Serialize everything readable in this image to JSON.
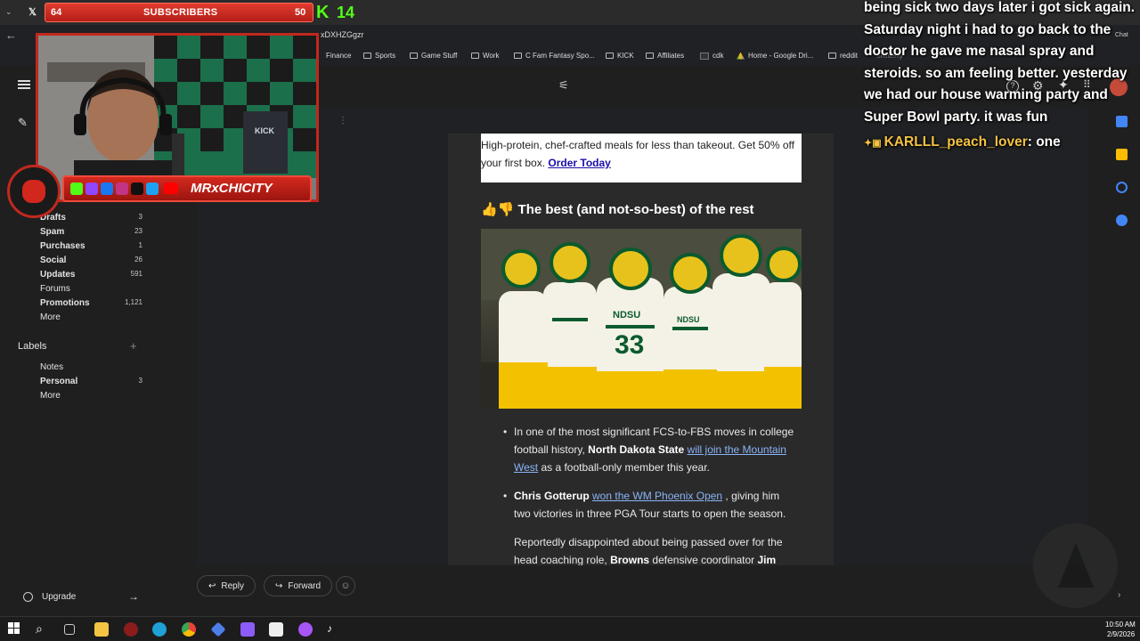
{
  "browser": {
    "url_fragment": "xDXHZGgzr",
    "bookmarks": [
      "Finance",
      "Sports",
      "Game Stuff",
      "Work",
      "C Fam Fantasy Spo...",
      "KICK",
      "Affiliates",
      "cdk",
      "Home - Google Dri...",
      "reddit",
      "Shutterfly"
    ]
  },
  "stream_overlay": {
    "subscribers_label": "SUBSCRIBERS",
    "subscribers_current": "64",
    "subscribers_goal": "50",
    "kick_count": "14",
    "streamer_name": "MRxCHICITY",
    "shirt_text": "KICK"
  },
  "sidebar": {
    "items": [
      {
        "label": "Drafts",
        "count": "3"
      },
      {
        "label": "Spam",
        "count": "23"
      },
      {
        "label": "Purchases",
        "count": "1"
      },
      {
        "label": "Social",
        "count": "26"
      },
      {
        "label": "Updates",
        "count": "591"
      },
      {
        "label": "Forums",
        "count": ""
      },
      {
        "label": "Promotions",
        "count": "1,121"
      },
      {
        "label": "More",
        "count": ""
      }
    ],
    "labels_heading": "Labels",
    "labels": [
      {
        "label": "Notes",
        "count": ""
      },
      {
        "label": "Personal",
        "count": "3"
      },
      {
        "label": "More",
        "count": ""
      }
    ],
    "upgrade": "Upgrade"
  },
  "email": {
    "promo_text": "High-protein, chef-crafted meals for less than takeout. Get 50% off your first box.",
    "promo_link": "Order Today",
    "section_heading": "The best (and not-so-best) of the rest",
    "section_emoji": "👍👎",
    "photo_jersey": "NDSU",
    "bullets": [
      {
        "pre": "In one of the most significant FCS-to-FBS moves in college football history, ",
        "bold": "North Dakota State",
        "link": "will join the Mountain West",
        "post": " as a football-only member this year."
      },
      {
        "pre": "",
        "bold": "Chris Gotterup",
        "link": "won the WM Phoenix Open",
        "post": " , giving him two victories in three PGA Tour starts to open the season."
      },
      {
        "pre": "Reportedly disappointed about being passed over for the head coaching role, ",
        "bold": "Browns",
        "link": "",
        "post": " defensive coordinator ",
        "bold2": "Jim"
      }
    ]
  },
  "actions": {
    "reply": "Reply",
    "forward": "Forward"
  },
  "chat": {
    "line1": "being sick two days later i got sick again. Saturday night i had to go back to the doctor he gave me nasal spray and steroids. so am feeling better. yesterday we had our house warming party and Super Bowl party. it was fun",
    "username": "KARLLL_peach_lover",
    "message2": ": one",
    "chat_label": "Chat"
  },
  "taskbar": {
    "time": "10:50 AM",
    "date": "2/9/2026"
  }
}
